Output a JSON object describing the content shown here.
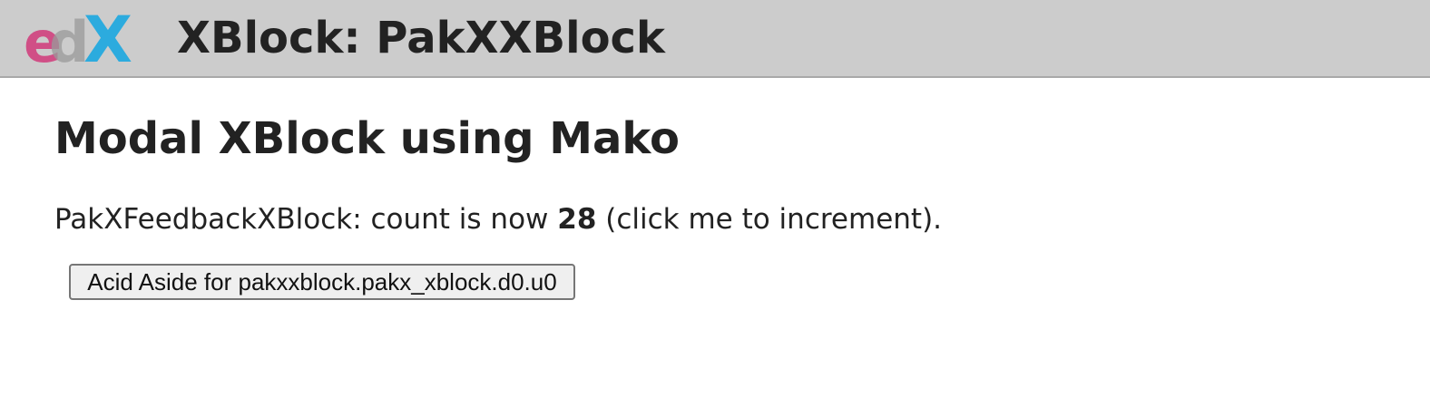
{
  "header": {
    "title": "XBlock: PakXXBlock",
    "logo": {
      "name": "edx-logo",
      "text": "edX",
      "colors": {
        "e": "#d0417e",
        "d": "#9a9a9a",
        "x": "#1ba7e0"
      }
    }
  },
  "main": {
    "title": "Modal XBlock using Mako",
    "counter": {
      "prefix": "PakXFeedbackXBlock: count is now ",
      "count": "28",
      "suffix": " (click me to increment)."
    },
    "aside_button_label": "Acid Aside for pakxxblock.pakx_xblock.d0.u0"
  }
}
